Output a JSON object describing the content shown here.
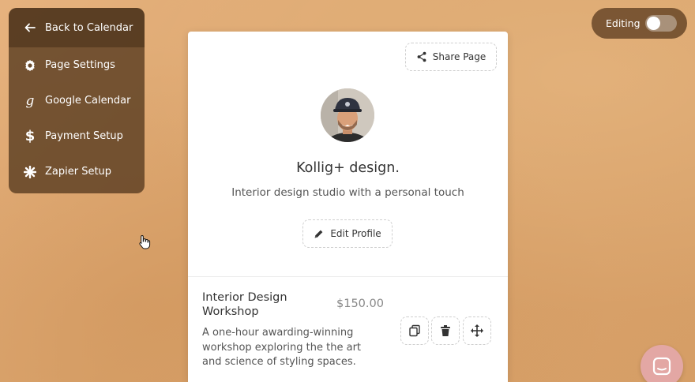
{
  "sidebar": {
    "back_label": "Back to Calendar",
    "items": [
      {
        "label": "Page Settings",
        "icon": "gear-icon"
      },
      {
        "label": "Google Calendar",
        "icon": "google-icon"
      },
      {
        "label": "Payment Setup",
        "icon": "dollar-icon"
      },
      {
        "label": "Zapier Setup",
        "icon": "zapier-icon"
      }
    ]
  },
  "header": {
    "editing_label": "Editing",
    "editing_on": false
  },
  "profile": {
    "share_label": "Share Page",
    "name": "Kollig+ design.",
    "tagline": "Interior design studio with a personal touch",
    "edit_label": "Edit Profile"
  },
  "service": {
    "title": "Interior Design Workshop",
    "price": "$150.00",
    "description": "A one-hour awarding-winning workshop exploring the the art and science of styling spaces."
  },
  "colors": {
    "background": "#daa46c",
    "menu": "#5c3e22",
    "chat": "#e3a7a4"
  }
}
